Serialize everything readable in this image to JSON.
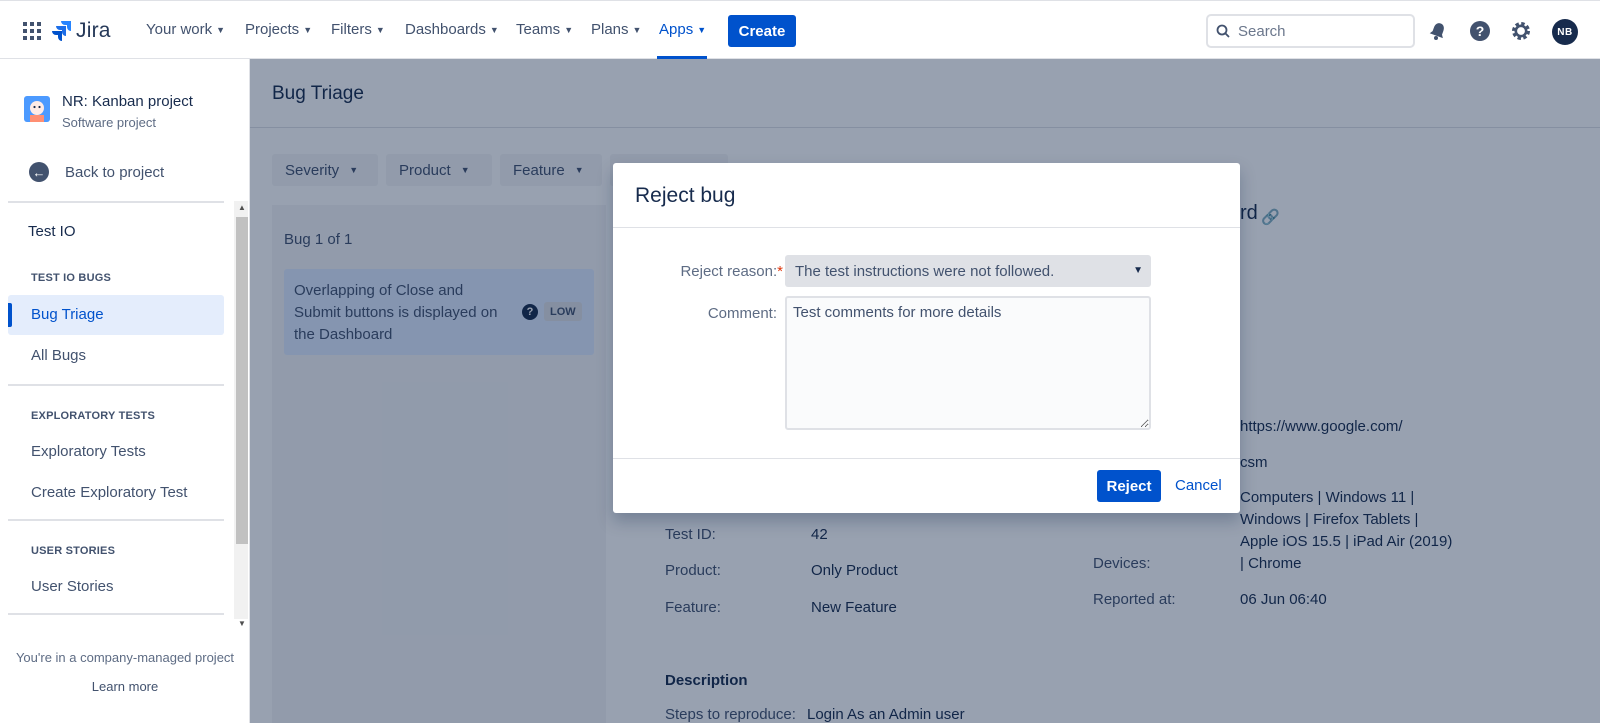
{
  "topnav": {
    "logo_text": "Jira",
    "items": [
      {
        "label": "Your work"
      },
      {
        "label": "Projects"
      },
      {
        "label": "Filters"
      },
      {
        "label": "Dashboards"
      },
      {
        "label": "Teams"
      },
      {
        "label": "Plans"
      },
      {
        "label": "Apps"
      }
    ],
    "active_item": "Apps",
    "create_label": "Create",
    "search_placeholder": "Search",
    "avatar_initials": "NB",
    "accent_color": "#0052cc"
  },
  "sidebar": {
    "project_name": "NR: Kanban project",
    "project_type": "Software project",
    "back_label": "Back to project",
    "app_name": "Test IO",
    "sections": [
      {
        "heading": "TEST IO BUGS",
        "items": [
          "Bug Triage",
          "All Bugs"
        ]
      },
      {
        "heading": "EXPLORATORY TESTS",
        "items": [
          "Exploratory Tests",
          "Create Exploratory Test"
        ]
      },
      {
        "heading": "USER STORIES",
        "items": [
          "User Stories"
        ]
      }
    ],
    "active_item": "Bug Triage",
    "footer_text": "You're in a company-managed project",
    "footer_link": "Learn more"
  },
  "main": {
    "title": "Bug Triage",
    "filters": [
      "Severity",
      "Product",
      "Feature"
    ],
    "bug_count": "Bug 1 of 1",
    "bug_card": {
      "title": "Overlapping of Close and Submit buttons is displayed on the Dashboard",
      "severity": "LOW"
    },
    "detail": {
      "title_fragment": "rd",
      "left_fields": [
        {
          "label": "Test ID:",
          "value": "42"
        },
        {
          "label": "Product:",
          "value": "Only Product"
        },
        {
          "label": "Feature:",
          "value": "New Feature"
        }
      ],
      "url_value": "https://www.google.com/",
      "tester_value": "csm",
      "devices_label": "Devices:",
      "devices_value": "Computers | Windows 11 | Windows | Firefox Tablets | Apple iOS 15.5 | iPad Air (2019) | Chrome",
      "reported_label": "Reported at:",
      "reported_value": "06 Jun 06:40",
      "description_heading": "Description",
      "steps_label": "Steps to reproduce:",
      "steps_value": "Login As an Admin user"
    }
  },
  "modal": {
    "title": "Reject bug",
    "reason_label": "Reject reason:",
    "required_mark": "*",
    "reason_value": "The test instructions were not followed.",
    "comment_label": "Comment:",
    "comment_value": "Test comments for more details",
    "reject_label": "Reject",
    "cancel_label": "Cancel"
  }
}
